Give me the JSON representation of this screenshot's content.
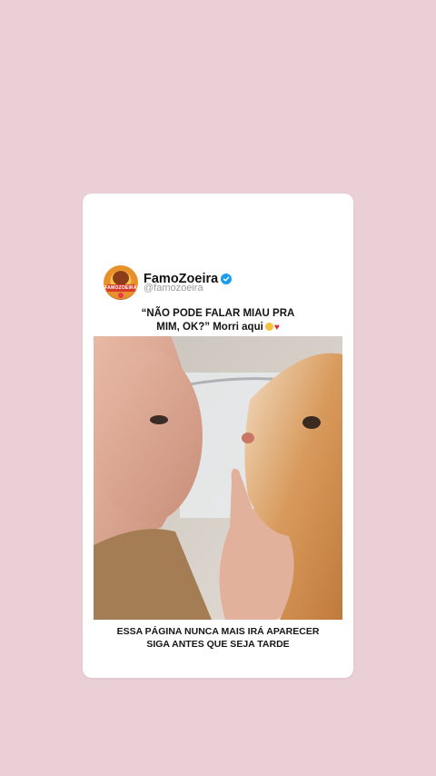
{
  "post": {
    "display_name": "FamoZoeira",
    "handle": "@famozoeira",
    "verified_icon": "verified-badge-icon",
    "avatar_text": "FAMOZOEIRA",
    "caption_line1": "“NÃO PODE FALAR MIAU PRA",
    "caption_line2": "MIM, OK?” Morri aqui",
    "caption_emojis": [
      "laughing-emoji-icon",
      "heart-emoji-icon"
    ],
    "media": "baby-and-cat-video",
    "footer_line1": "ESSA PÁGINA NUNCA MAIS IRÁ APARECER",
    "footer_line2": "SIGA ANTES QUE SEJA TARDE"
  },
  "colors": {
    "background": "#ead0d6",
    "card": "#ffffff",
    "verified": "#1d9bf0",
    "heart": "#e0293b"
  }
}
